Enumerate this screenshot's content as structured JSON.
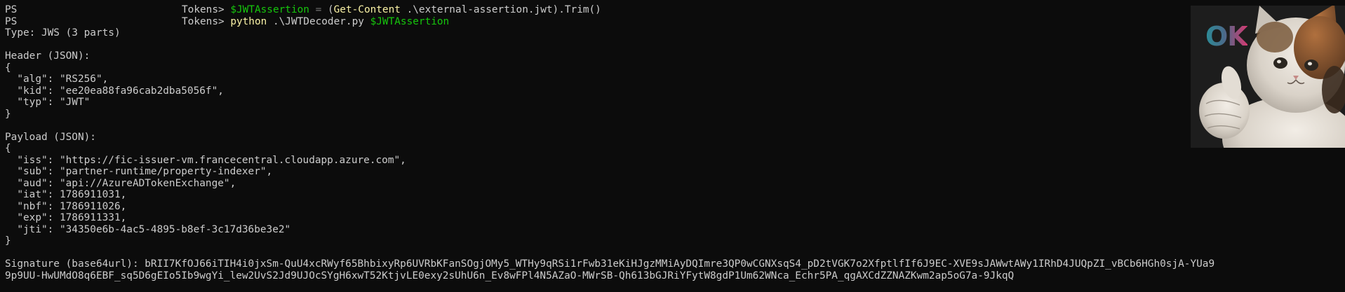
{
  "terminal": {
    "prompts": [
      {
        "ps": "PS",
        "path": "Tokens>",
        "tokens": [
          {
            "text": "$JWTAssertion",
            "kind": "var"
          },
          {
            "text": " = ",
            "kind": "op"
          },
          {
            "text": "(",
            "kind": "text"
          },
          {
            "text": "Get-Content",
            "kind": "cmd"
          },
          {
            "text": " .\\external-assertion.jwt).Trim()",
            "kind": "text"
          }
        ]
      },
      {
        "ps": "PS",
        "path": "Tokens>",
        "tokens": [
          {
            "text": "python",
            "kind": "cmd"
          },
          {
            "text": " .\\JWTDecoder.py ",
            "kind": "text"
          },
          {
            "text": "$JWTAssertion",
            "kind": "var"
          }
        ]
      }
    ],
    "output_lines": [
      "Type: JWS (3 parts)",
      "",
      "Header (JSON):",
      "{",
      "  \"alg\": \"RS256\",",
      "  \"kid\": \"ee20ea88fa96cab2dba5056f\",",
      "  \"typ\": \"JWT\"",
      "}",
      "",
      "Payload (JSON):",
      "{",
      "  \"iss\": \"https://fic-issuer-vm.francecentral.cloudapp.azure.com\",",
      "  \"sub\": \"partner-runtime/property-indexer\",",
      "  \"aud\": \"api://AzureADTokenExchange\",",
      "  \"iat\": 1786911031,",
      "  \"nbf\": 1786911026,",
      "  \"exp\": 1786911331,",
      "  \"jti\": \"34350e6b-4ac5-4895-b8ef-3c17d36be3e2\"",
      "}",
      "",
      "Signature (base64url): bRII7KfOJ66iTIH4i0jxSm-QuU4xcRWyf65BhbixyRp6UVRbKFanSOgjOMy5_WTHy9qRSi1rFwb31eKiHJgzMMiAyDQImre3QP0wCGNXsqS4_pD2tVGK7o2XfptlfIf6J9EC-XVE9sJAWwtAWy1IRhD4JUQpZI_vBCb6HGh0sjA-YUa9",
      "9p9UU-HwUMdO8q6EBF_sq5D6gEIo5Ib9wgYi_lew2UvS2Jd9UJOcSYgH6xwT52KtjvLE0exy2sUhU6n_Ev8wFPl4N5AZaO-MWrSB-Qh613bGJRiYFytW8gdP1Um62WNca_Echr5PA_qgAXCdZZNAZKwm2ap5oG7a-9JkqQ"
    ]
  },
  "sticker": {
    "text": "OK",
    "icon": "thumbs-up-cat-icon"
  },
  "colors": {
    "background": "#0c0c0c",
    "foreground": "#cccccc",
    "variable": "#16c60c",
    "command": "#f9f1a5",
    "operator": "#767676"
  }
}
